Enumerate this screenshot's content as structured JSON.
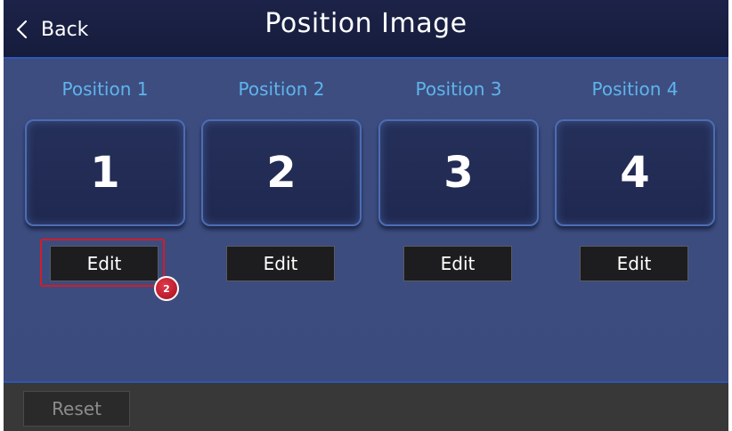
{
  "header": {
    "back_label": "Back",
    "back_icon": "chevron-left-icon",
    "title": "Position Image"
  },
  "positions": [
    {
      "label": "Position 1",
      "number": "1",
      "edit_label": "Edit"
    },
    {
      "label": "Position 2",
      "number": "2",
      "edit_label": "Edit"
    },
    {
      "label": "Position 3",
      "number": "3",
      "edit_label": "Edit"
    },
    {
      "label": "Position 4",
      "number": "4",
      "edit_label": "Edit"
    }
  ],
  "annotation": {
    "step": "2"
  },
  "footer": {
    "reset_label": "Reset"
  },
  "colors": {
    "header_bg": "#1c2348",
    "content_bg": "#3d4d80",
    "label_accent": "#5fb4ec",
    "tile_bg": "#25305a",
    "button_bg": "#1d1d1f",
    "footer_bg": "#383838",
    "highlight": "#d21c2a"
  }
}
